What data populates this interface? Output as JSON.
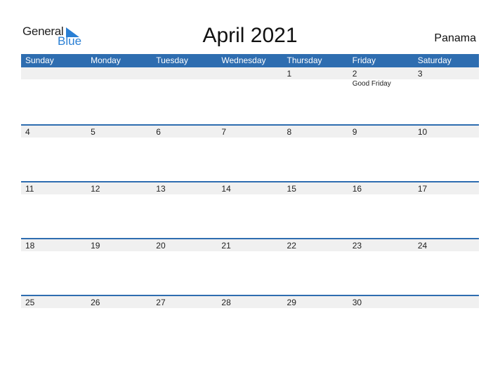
{
  "logo": {
    "word1": "General",
    "word2": "Blue"
  },
  "title": "April 2021",
  "country": "Panama",
  "colors": {
    "header_bg": "#2e6db0",
    "strip_bg": "#f0f0f0",
    "logo_blue": "#2a7fd4"
  },
  "weekdays": [
    "Sunday",
    "Monday",
    "Tuesday",
    "Wednesday",
    "Thursday",
    "Friday",
    "Saturday"
  ],
  "weeks": [
    {
      "days": [
        "",
        "",
        "",
        "",
        "1",
        "2",
        "3"
      ],
      "events": [
        "",
        "",
        "",
        "",
        "",
        "Good Friday",
        ""
      ]
    },
    {
      "days": [
        "4",
        "5",
        "6",
        "7",
        "8",
        "9",
        "10"
      ],
      "events": [
        "",
        "",
        "",
        "",
        "",
        "",
        ""
      ]
    },
    {
      "days": [
        "11",
        "12",
        "13",
        "14",
        "15",
        "16",
        "17"
      ],
      "events": [
        "",
        "",
        "",
        "",
        "",
        "",
        ""
      ]
    },
    {
      "days": [
        "18",
        "19",
        "20",
        "21",
        "22",
        "23",
        "24"
      ],
      "events": [
        "",
        "",
        "",
        "",
        "",
        "",
        ""
      ]
    },
    {
      "days": [
        "25",
        "26",
        "27",
        "28",
        "29",
        "30",
        ""
      ],
      "events": [
        "",
        "",
        "",
        "",
        "",
        "",
        ""
      ]
    }
  ]
}
